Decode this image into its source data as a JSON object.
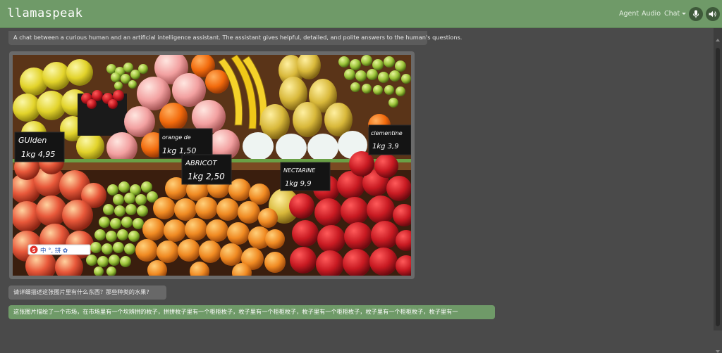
{
  "app": {
    "title": "llamaspeak"
  },
  "nav": {
    "agent_label": "Agent",
    "audio_label": "Audio",
    "chat_label": "Chat",
    "mic_icon": "microphone-icon",
    "speaker_icon": "speaker-icon"
  },
  "chat": {
    "system_prompt": "A chat between a curious human and an artificial intelligence assistant. The assistant gives helpful, detailed, and polite answers to the human's questions.",
    "image": {
      "description": "photo of fruit market stall with price signs",
      "signs": [
        {
          "line1": "GUlden",
          "line2": "1kg 4,95"
        },
        {
          "line1": "orange de",
          "line2": "1kg 1,50"
        },
        {
          "line1": "ABRICOT",
          "line2": "1kg 2,50"
        },
        {
          "line1": "NECTARINE",
          "line2": "1kg 9,9"
        },
        {
          "line1": "clementine",
          "line2": "1kg 3,9"
        }
      ],
      "ime_toolbar": "中 °, 拼 ✿"
    },
    "user_message": "请详细描述这张图片里有什么东西？那些种类的水果?",
    "assistant_message": "这张图片描绘了一个市场，在市场里有一个坎辨拼的枚子，拼拼枚子里有一个柜柜枚子，枚子里有一个柜柜枚子，枚子里有一个柜柜枚子，枚子里有一个柜柜枚子，枚子里有一"
  },
  "colors": {
    "navbar": "#6f9a68",
    "background": "#4a4a4a",
    "assistant_bubble": "#6f9a68",
    "user_bubble": "#686868"
  }
}
